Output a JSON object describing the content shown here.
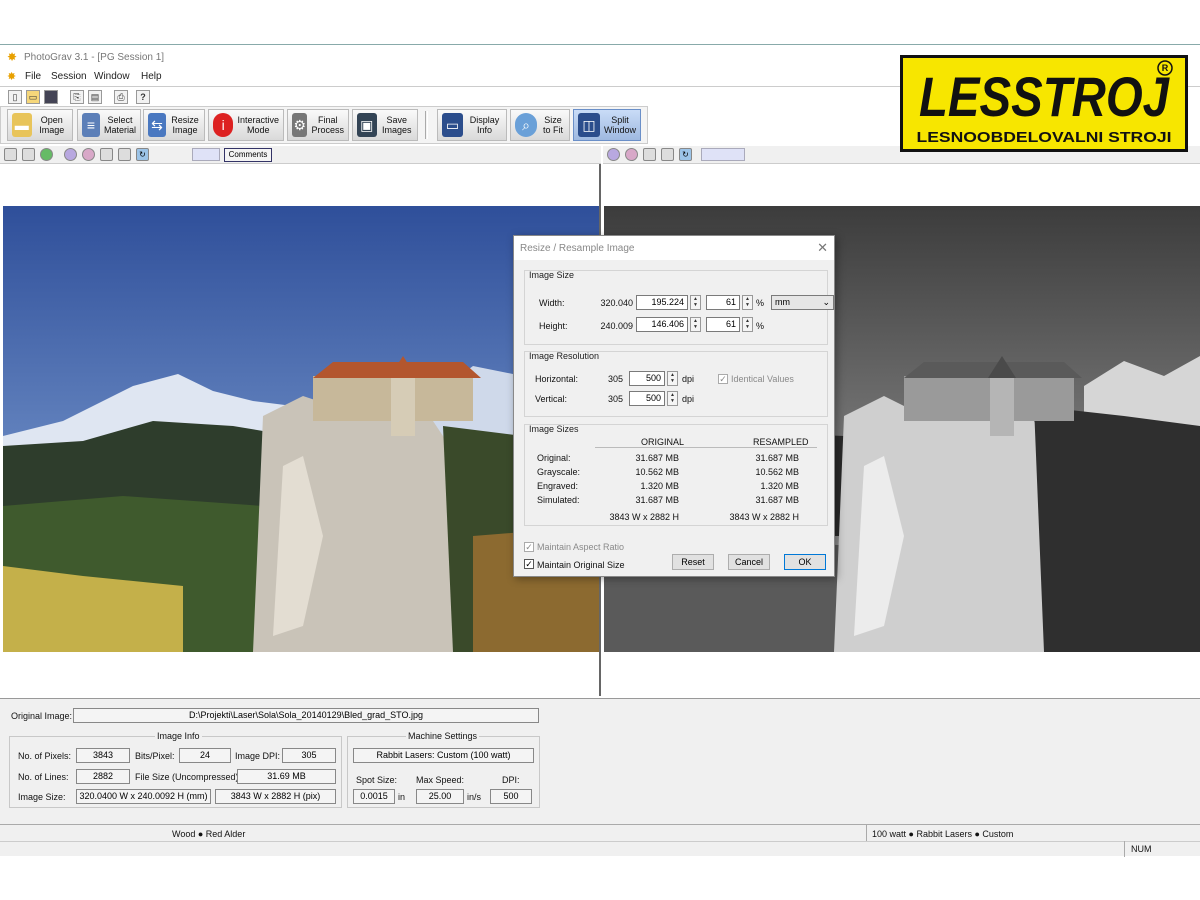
{
  "window": {
    "title": "PhotoGrav 3.1 - [PG Session 1]"
  },
  "menu": [
    "File",
    "Session",
    "Window",
    "Help"
  ],
  "toolbar": {
    "buttons": [
      {
        "line1": "Open",
        "line2": "Image",
        "icon": "open-folder-icon"
      },
      {
        "line1": "Select",
        "line2": "Material",
        "icon": "material-list-icon"
      },
      {
        "line1": "Resize",
        "line2": "Image",
        "icon": "resize-people-icon"
      },
      {
        "line1": "Interactive",
        "line2": "Mode",
        "icon": "info-circle-icon"
      },
      {
        "line1": "Final",
        "line2": "Process",
        "icon": "gear-icon"
      },
      {
        "line1": "Save",
        "line2": "Images",
        "icon": "floppy-disk-icon"
      },
      {
        "line1": "Display",
        "line2": "Info",
        "icon": "monitor-icon"
      },
      {
        "line1": "Size",
        "line2": "to Fit",
        "icon": "magnifier-icon"
      },
      {
        "line1": "Split",
        "line2": "Window",
        "icon": "split-window-icon"
      }
    ]
  },
  "left_pane": {
    "comments_label": "Comments"
  },
  "dialog": {
    "title": "Resize / Resample Image",
    "image_size": {
      "group_label": "Image Size",
      "width_label": "Width:",
      "width_original": "320.040",
      "width_new": "195.224",
      "width_percent": "61",
      "height_label": "Height:",
      "height_original": "240.009",
      "height_new": "146.406",
      "height_percent": "61",
      "percent_sign": "%",
      "unit": "mm"
    },
    "resolution": {
      "group_label": "Image Resolution",
      "horizontal_label": "Horizontal:",
      "horizontal_original": "305",
      "horizontal_new": "500",
      "vertical_label": "Vertical:",
      "vertical_original": "305",
      "vertical_new": "500",
      "unit": "dpi",
      "identical_label": "Identical Values"
    },
    "sizes": {
      "group_label": "Image Sizes",
      "col_original": "ORIGINAL",
      "col_resampled": "RESAMPLED",
      "rows": [
        {
          "label": "Original:",
          "original": "31.687 MB",
          "resampled": "31.687 MB"
        },
        {
          "label": "Grayscale:",
          "original": "10.562 MB",
          "resampled": "10.562 MB"
        },
        {
          "label": "Engraved:",
          "original": "1.320 MB",
          "resampled": "1.320 MB"
        },
        {
          "label": "Simulated:",
          "original": "31.687 MB",
          "resampled": "31.687 MB"
        }
      ],
      "dims_original": "3843 W  x  2882 H",
      "dims_resampled": "3843 W  x  2882 H"
    },
    "maintain_aspect_label": "Maintain Aspect Ratio",
    "maintain_original_label": "Maintain Original Size",
    "reset_label": "Reset",
    "cancel_label": "Cancel",
    "ok_label": "OK"
  },
  "info": {
    "original_image_label": "Original Image:",
    "original_image_path": "D:\\Projekti\\Laser\\Sola\\Sola_20140129\\Bled_grad_STO.jpg",
    "image_info_title": "Image Info",
    "pixels_label": "No. of Pixels:",
    "pixels": "3843",
    "bits_label": "Bits/Pixel:",
    "bits": "24",
    "dpi_label": "Image DPI:",
    "dpi": "305",
    "lines_label": "No. of Lines:",
    "lines": "2882",
    "filesize_label": "File Size (Uncompressed):",
    "filesize": "31.69 MB",
    "imagesize_label": "Image Size:",
    "imagesize_mm": "320.0400 W x 240.0092 H (mm)",
    "imagesize_pix": "3843 W x 2882 H (pix)",
    "machine_title": "Machine Settings",
    "machine": "Rabbit Lasers: Custom (100 watt)",
    "spot_label": "Spot Size:",
    "spot": "0.0015",
    "spot_unit": "in",
    "speed_label": "Max Speed:",
    "speed": "25.00",
    "speed_unit": "in/s",
    "mdpi_label": "DPI:",
    "mdpi": "500"
  },
  "status": {
    "material": "Wood ● Red Alder",
    "laser": "100 watt ● Rabbit Lasers ● Custom",
    "num": "NUM"
  },
  "logo": {
    "text": "LESSTROJ",
    "tagline": "LESNOOBDELOVALNI STROJI",
    "mark": "R"
  }
}
